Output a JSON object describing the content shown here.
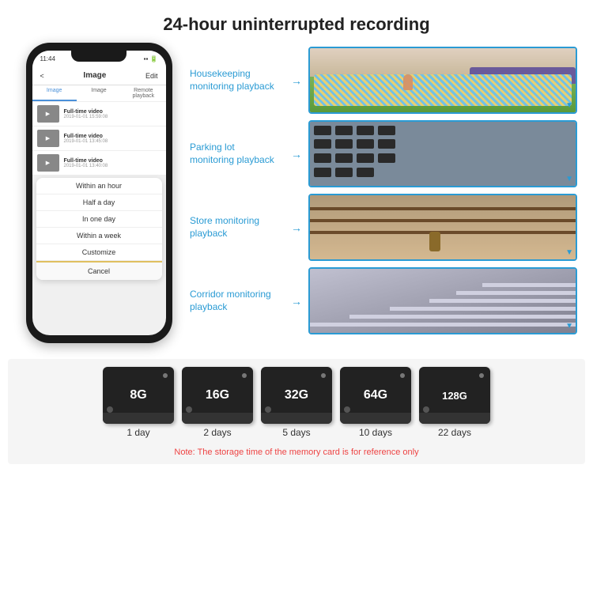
{
  "header": {
    "title": "24-hour uninterrupted recording"
  },
  "phone": {
    "time": "11:44",
    "nav": {
      "back": "<",
      "title": "Image",
      "edit": "Edit"
    },
    "tabs": [
      "Image",
      "Image",
      "Remote playback"
    ],
    "videos": [
      {
        "title": "Full-time video",
        "date": "2019-01-01 15:59:08"
      },
      {
        "title": "Full-time video",
        "date": "2019-01-01 13:45:08"
      },
      {
        "title": "Full-time video",
        "date": "2019-01-01 13:40:08"
      }
    ],
    "dropdown": {
      "items": [
        "Within an hour",
        "Half a day",
        "In one day",
        "Within a week",
        "Customize"
      ],
      "cancel": "Cancel"
    }
  },
  "monitoring": {
    "items": [
      {
        "label": "Housekeeping\nmonitoring playback"
      },
      {
        "label": "Parking lot\nmonitoring playback"
      },
      {
        "label": "Store monitoring\nplayback"
      },
      {
        "label": "Corridor monitoring\nplayback"
      }
    ]
  },
  "storage": {
    "cards": [
      {
        "size": "8G",
        "days": "1 day"
      },
      {
        "size": "16G",
        "days": "2 days"
      },
      {
        "size": "32G",
        "days": "5 days"
      },
      {
        "size": "64G",
        "days": "10 days"
      },
      {
        "size": "128G",
        "days": "22 days"
      }
    ],
    "note": "Note: The storage time of the memory card is for reference only"
  }
}
